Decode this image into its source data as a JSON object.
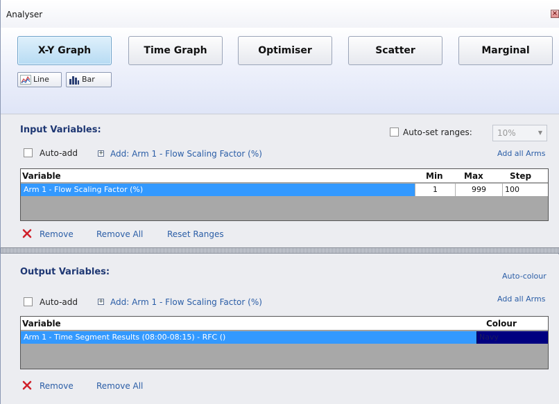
{
  "window": {
    "title": "Analyser"
  },
  "tabs": [
    {
      "label": "X-Y Graph",
      "active": true
    },
    {
      "label": "Time Graph",
      "active": false
    },
    {
      "label": "Optimiser",
      "active": false
    },
    {
      "label": "Scatter",
      "active": false
    },
    {
      "label": "Marginal",
      "active": false
    }
  ],
  "chart_types": {
    "line": "Line",
    "bar": "Bar"
  },
  "input": {
    "title": "Input Variables:",
    "auto_set_ranges": "Auto-set ranges:",
    "percent": "10%",
    "auto_add": "Auto-add",
    "add_link": "Add: Arm 1 - Flow Scaling Factor (%)",
    "add_all_arms": "Add all Arms",
    "columns": {
      "variable": "Variable",
      "min": "Min",
      "max": "Max",
      "step": "Step"
    },
    "rows": [
      {
        "variable": "Arm 1 - Flow Scaling Factor (%)",
        "min": "1",
        "max": "999",
        "step": "100"
      }
    ],
    "actions": {
      "remove": "Remove",
      "remove_all": "Remove All",
      "reset_ranges": "Reset Ranges"
    }
  },
  "output": {
    "title": "Output Variables:",
    "auto_colour": "Auto-colour",
    "auto_add": "Auto-add",
    "add_link": "Add: Arm 1 - Flow Scaling Factor (%)",
    "add_all_arms": "Add all Arms",
    "columns": {
      "variable": "Variable",
      "colour": "Colour"
    },
    "rows": [
      {
        "variable": "Arm 1 - Time Segment Results (08:00-08:15) - RFC ()",
        "colour": "Navy",
        "colour_hex": "#000080"
      }
    ],
    "actions": {
      "remove": "Remove",
      "remove_all": "Remove All"
    }
  },
  "colors": {
    "accent_title": "#1e3773",
    "link": "#2a5da6",
    "selection": "#3399ff",
    "remove": "#d0202a"
  }
}
